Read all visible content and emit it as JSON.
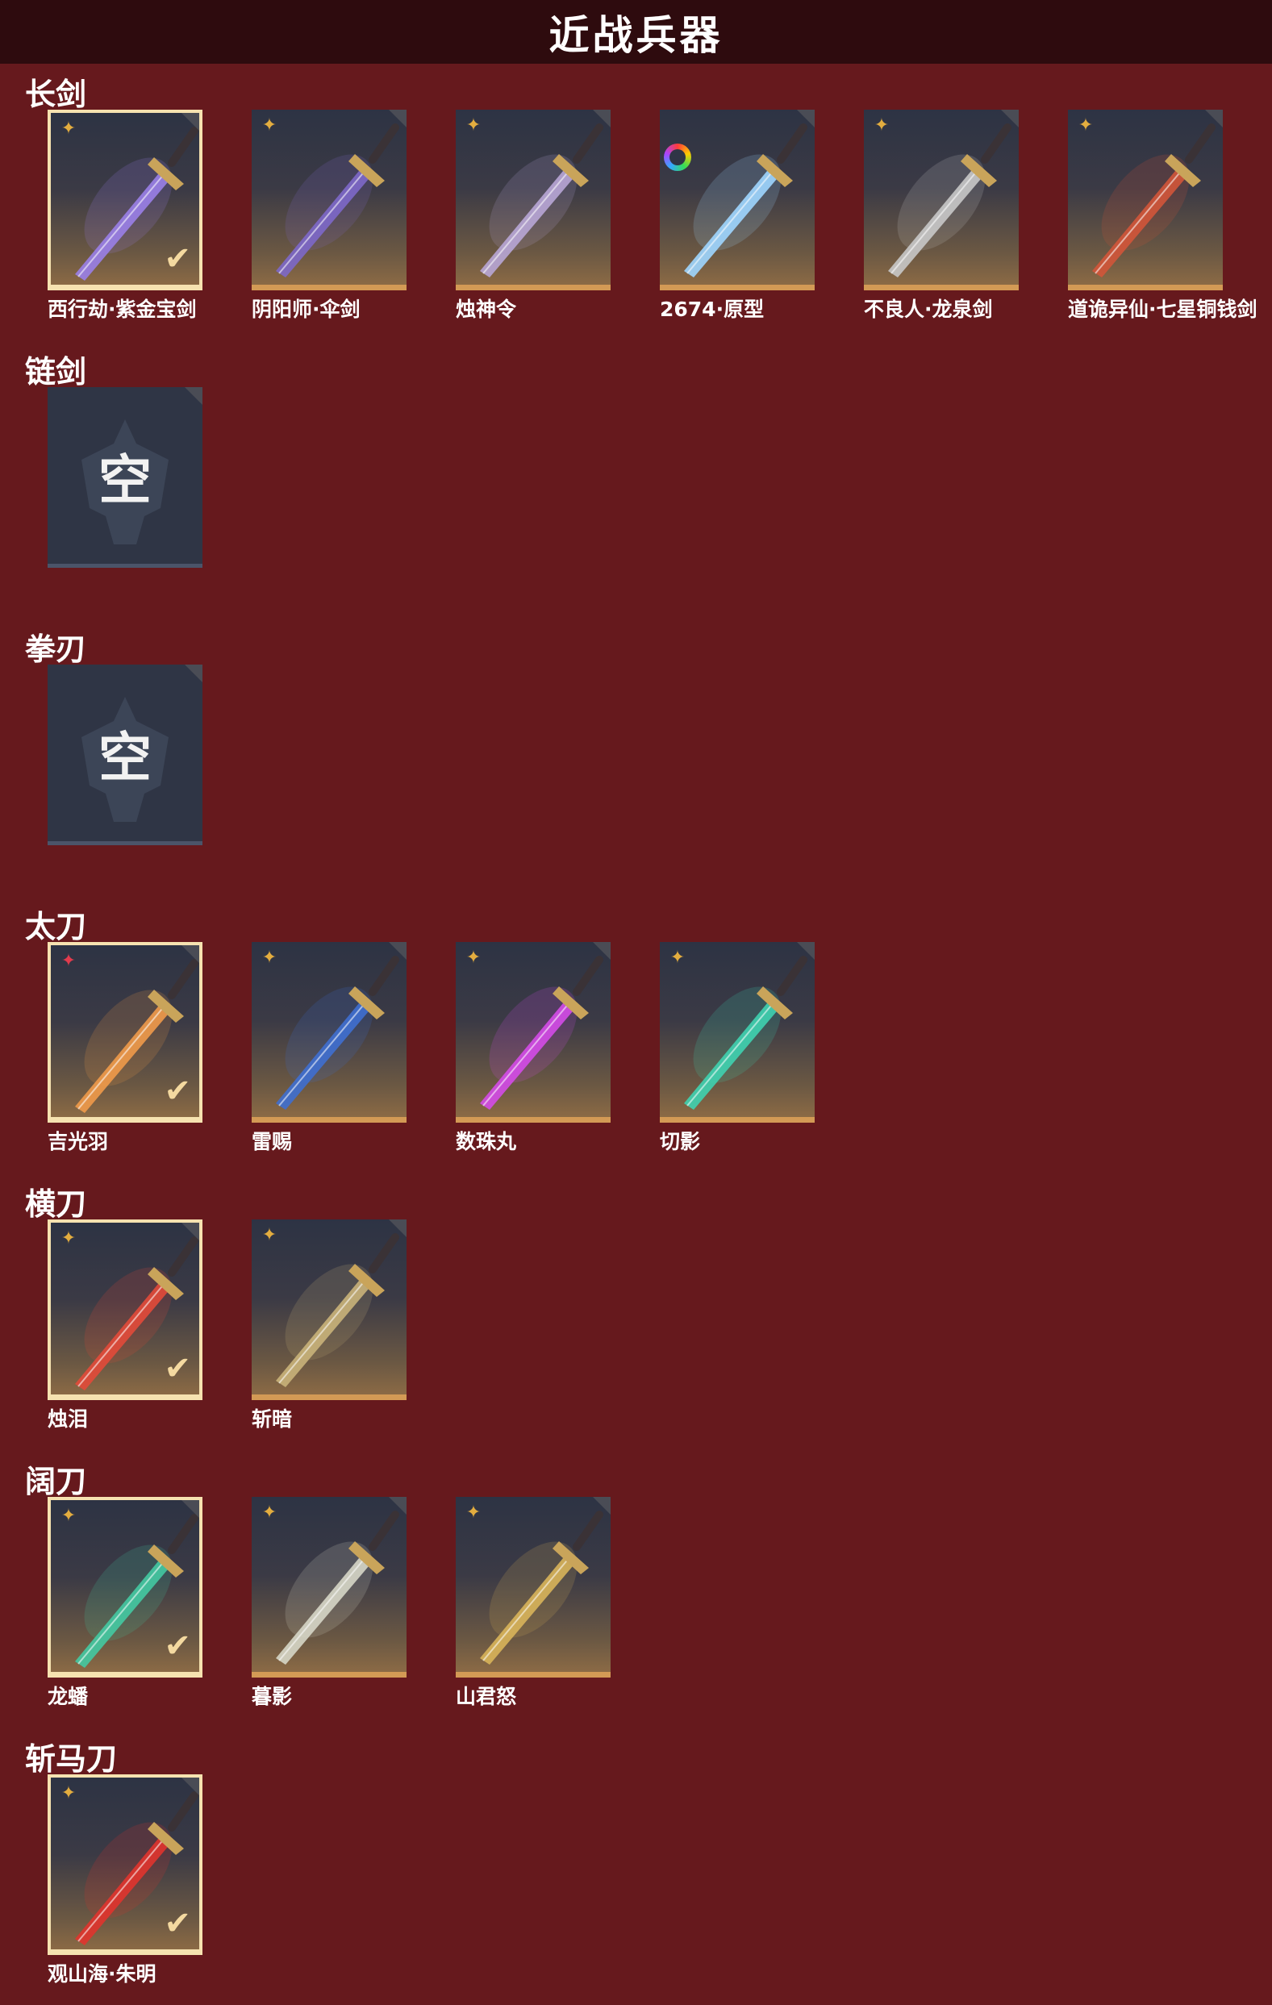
{
  "header": {
    "title": "近战兵器"
  },
  "empty_label": "空",
  "sections": [
    {
      "title": "长剑",
      "items": [
        {
          "name": "西行劫·紫金宝剑",
          "selected": true,
          "badge": "star4",
          "color": "#9a7fe8"
        },
        {
          "name": "阴阳师·伞剑",
          "selected": false,
          "badge": "star4",
          "color": "#7d68c9"
        },
        {
          "name": "烛神令",
          "selected": false,
          "badge": "star4",
          "color": "#b8a6d6"
        },
        {
          "name": "2674·原型",
          "selected": false,
          "badge": "ring",
          "color": "#9fd6ff"
        },
        {
          "name": "不良人·龙泉剑",
          "selected": false,
          "badge": "star4",
          "color": "#c8c8c8"
        },
        {
          "name": "道诡异仙·七星铜钱剑",
          "selected": false,
          "badge": "star4",
          "color": "#d2553a"
        }
      ]
    },
    {
      "title": "链剑",
      "items": [
        {
          "name": "",
          "empty": true
        }
      ]
    },
    {
      "title": "拳刃",
      "items": [
        {
          "name": "",
          "empty": true
        }
      ]
    },
    {
      "title": "太刀",
      "items": [
        {
          "name": "吉光羽",
          "selected": true,
          "badge": "red-star",
          "color": "#f09a4a"
        },
        {
          "name": "雷赐",
          "selected": false,
          "badge": "star4",
          "color": "#3f6fd0"
        },
        {
          "name": "数珠丸",
          "selected": false,
          "badge": "star4",
          "color": "#d44be8"
        },
        {
          "name": "切影",
          "selected": false,
          "badge": "star4",
          "color": "#3fd2b0"
        }
      ]
    },
    {
      "title": "横刀",
      "items": [
        {
          "name": "烛泪",
          "selected": true,
          "badge": "star4",
          "color": "#e24a3a"
        },
        {
          "name": "斩暗",
          "selected": false,
          "badge": "star4",
          "color": "#c9b27a"
        }
      ]
    },
    {
      "title": "阔刀",
      "items": [
        {
          "name": "龙蟠",
          "selected": true,
          "badge": "star4",
          "color": "#44c9a2"
        },
        {
          "name": "暮影",
          "selected": false,
          "badge": "star4",
          "color": "#d6d6c6"
        },
        {
          "name": "山君怒",
          "selected": false,
          "badge": "star4",
          "color": "#d8b45a"
        }
      ]
    },
    {
      "title": "斩马刀",
      "items": [
        {
          "name": "观山海·朱明",
          "selected": true,
          "badge": "star4",
          "color": "#e0342e"
        }
      ]
    }
  ]
}
